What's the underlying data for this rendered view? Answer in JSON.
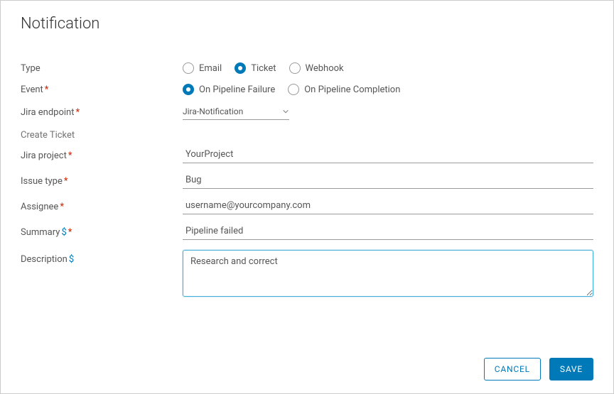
{
  "title": "Notification",
  "labels": {
    "type": "Type",
    "event": "Event",
    "jira_endpoint": "Jira endpoint",
    "create_ticket": "Create Ticket",
    "jira_project": "Jira project",
    "issue_type": "Issue type",
    "assignee": "Assignee",
    "summary": "Summary",
    "description": "Description"
  },
  "type_options": {
    "email": "Email",
    "ticket": "Ticket",
    "webhook": "Webhook",
    "selected": "ticket"
  },
  "event_options": {
    "failure": "On Pipeline Failure",
    "completion": "On Pipeline Completion",
    "selected": "failure"
  },
  "fields": {
    "jira_endpoint": "Jira-Notification",
    "jira_project": "YourProject",
    "issue_type": "Bug",
    "assignee": "username@yourcompany.com",
    "summary": "Pipeline failed",
    "description": "Research and correct"
  },
  "buttons": {
    "cancel": "Cancel",
    "save": "Save"
  }
}
